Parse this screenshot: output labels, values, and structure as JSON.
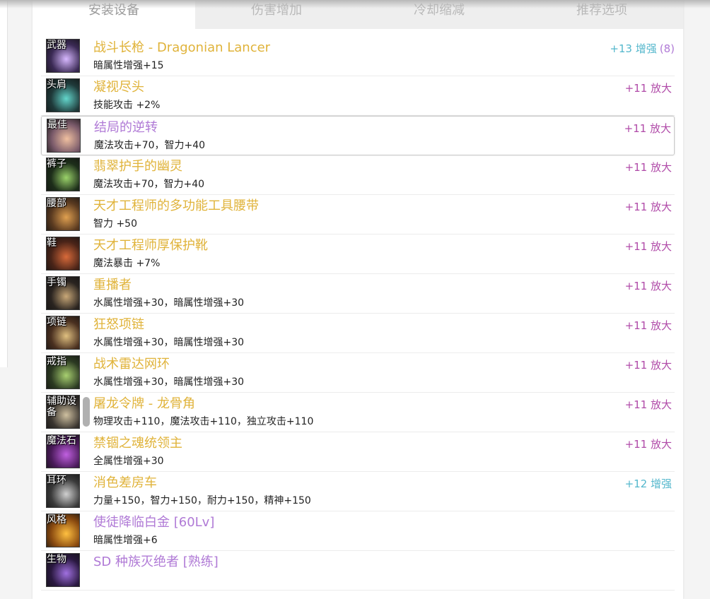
{
  "colors": {
    "gold": "#e0b33a",
    "purple": "#b07ad6",
    "magenta": "#b04aa8",
    "cyan": "#54b7cc"
  },
  "tabs": [
    {
      "label": "安装设备",
      "active": true
    },
    {
      "label": "伤害增加",
      "active": false
    },
    {
      "label": "冷却缩减",
      "active": false
    },
    {
      "label": "推荐选项",
      "active": false
    }
  ],
  "items": [
    {
      "slot": "武器",
      "name": "战斗长枪 - Dragonian Lancer",
      "stats": "暗属性增强+15",
      "upgrade": "+13 增强",
      "upgrade_extra": "(8)",
      "rarity": "gold",
      "upgrade_color": "cyan",
      "extra_color": "purple",
      "bg": "#3b2a55",
      "accent": "#d7b8ff"
    },
    {
      "slot": "头肩",
      "name": "凝视尽头",
      "stats": "技能攻击 +2%",
      "upgrade": "+11 放大",
      "upgrade_extra": "",
      "rarity": "gold",
      "upgrade_color": "magenta",
      "extra_color": "purple",
      "bg": "#1f3a3a",
      "accent": "#63d6cc"
    },
    {
      "slot": "最佳",
      "name": "结局的逆转",
      "stats": "魔法攻击+70，智力+40",
      "upgrade": "+11 放大",
      "upgrade_extra": "",
      "rarity": "purple",
      "upgrade_color": "magenta",
      "extra_color": "purple",
      "bg": "#7a5a6a",
      "accent": "#f0c0a0"
    },
    {
      "slot": "裤子",
      "name": "翡翠护手的幽灵",
      "stats": "魔法攻击+70，智力+40",
      "upgrade": "+11 放大",
      "upgrade_extra": "",
      "rarity": "gold",
      "upgrade_color": "magenta",
      "extra_color": "purple",
      "bg": "#1d2e1a",
      "accent": "#9bd36a"
    },
    {
      "slot": "腰部",
      "name": "天才工程师的多功能工具腰带",
      "stats": "智力 +50",
      "upgrade": "+11 放大",
      "upgrade_extra": "",
      "rarity": "gold",
      "upgrade_color": "magenta",
      "extra_color": "purple",
      "bg": "#5a3a20",
      "accent": "#e0a050"
    },
    {
      "slot": "鞋",
      "name": "天才工程师厚保护靴",
      "stats": "魔法暴击 +7%",
      "upgrade": "+11 放大",
      "upgrade_extra": "",
      "rarity": "gold",
      "upgrade_color": "magenta",
      "extra_color": "purple",
      "bg": "#4a2418",
      "accent": "#d86a3a"
    },
    {
      "slot": "手镯",
      "name": "重播者",
      "stats": "水属性增强+30，暗属性增强+30",
      "upgrade": "+11 放大",
      "upgrade_extra": "",
      "rarity": "gold",
      "upgrade_color": "magenta",
      "extra_color": "purple",
      "bg": "#2a2420",
      "accent": "#c9a878"
    },
    {
      "slot": "项链",
      "name": "狂怒项链",
      "stats": "水属性增强+30，暗属性增强+30",
      "upgrade": "+11 放大",
      "upgrade_extra": "",
      "rarity": "gold",
      "upgrade_color": "magenta",
      "extra_color": "purple",
      "bg": "#4a3020",
      "accent": "#e0c080"
    },
    {
      "slot": "戒指",
      "name": "战术雷达网环",
      "stats": "水属性增强+30，暗属性增强+30",
      "upgrade": "+11 放大",
      "upgrade_extra": "",
      "rarity": "gold",
      "upgrade_color": "magenta",
      "extra_color": "purple",
      "bg": "#2c3a22",
      "accent": "#a8d070"
    },
    {
      "slot": "辅助设备",
      "name": "屠龙令牌 - 龙骨角",
      "stats": "物理攻击+110，魔法攻击+110，独立攻击+110",
      "upgrade": "+11 放大",
      "upgrade_extra": "",
      "rarity": "gold",
      "upgrade_color": "magenta",
      "extra_color": "purple",
      "bg": "#3a3530",
      "accent": "#cfc0a0"
    },
    {
      "slot": "魔法石",
      "name": "禁锢之魂统领主",
      "stats": "全属性增强+30",
      "upgrade": "+11 放大",
      "upgrade_extra": "",
      "rarity": "gold",
      "upgrade_color": "magenta",
      "extra_color": "purple",
      "bg": "#4a1a5a",
      "accent": "#c060e0"
    },
    {
      "slot": "耳环",
      "name": "消色差房车",
      "stats": "力量+150，智力+150，耐力+150，精神+150",
      "upgrade": "+12 增强",
      "upgrade_extra": "",
      "rarity": "gold",
      "upgrade_color": "cyan",
      "extra_color": "purple",
      "bg": "#3a3a3a",
      "accent": "#d0d0d0"
    },
    {
      "slot": "风格",
      "name": "使徒降临白金 [60Lv]",
      "stats": "暗属性增强+6",
      "upgrade": "",
      "upgrade_extra": "",
      "rarity": "purple",
      "upgrade_color": "cyan",
      "extra_color": "purple",
      "bg": "#8a4a10",
      "accent": "#ffc040"
    },
    {
      "slot": "生物",
      "name": "SD 种族灭绝者 [熟练]",
      "stats": "",
      "upgrade": "",
      "upgrade_extra": "",
      "rarity": "purple",
      "upgrade_color": "cyan",
      "extra_color": "purple",
      "bg": "#2a1840",
      "accent": "#a070e0"
    }
  ]
}
